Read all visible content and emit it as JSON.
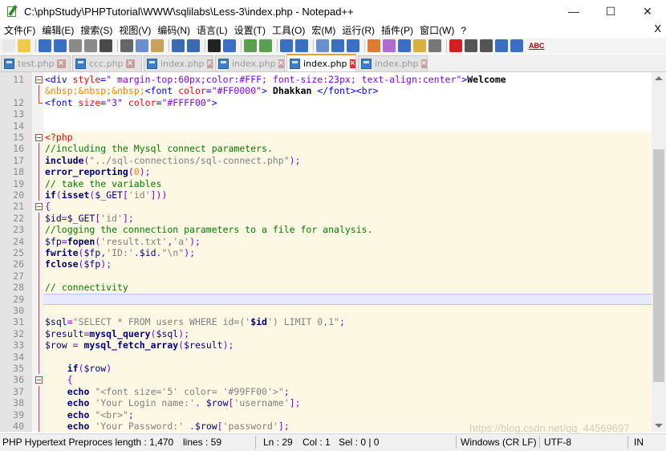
{
  "window": {
    "title": "C:\\phpStudy\\PHPTutorial\\WWW\\sqlilabs\\Less-3\\index.php - Notepad++",
    "minimize": "—",
    "maximize": "☐",
    "close": "✕"
  },
  "menu": {
    "items": [
      "文件(F)",
      "编辑(E)",
      "搜索(S)",
      "视图(V)",
      "编码(N)",
      "语言(L)",
      "设置(T)",
      "工具(O)",
      "宏(M)",
      "运行(R)",
      "插件(P)",
      "窗口(W)",
      "?"
    ],
    "close_doc": "X"
  },
  "toolbar": {
    "icons": [
      "new-file-icon",
      "open-file-icon",
      "save-icon",
      "save-all-icon",
      "close-icon",
      "close-all-icon",
      "print-icon",
      "cut-icon",
      "copy-icon",
      "paste-icon",
      "undo-icon",
      "redo-icon",
      "find-icon",
      "replace-icon",
      "zoom-in-icon",
      "zoom-out-icon",
      "sync-vertical-icon",
      "sync-horizontal-icon",
      "word-wrap-icon",
      "show-all-chars-icon",
      "indent-guide-icon",
      "user-lang-icon",
      "doc-map-icon",
      "function-list-icon",
      "folder-as-workspace-icon",
      "monitoring-icon",
      "record-macro-icon",
      "stop-macro-icon",
      "play-macro-icon",
      "run-macro-multiple-icon",
      "save-macro-icon"
    ],
    "spellcheck": "ABC"
  },
  "tabs": [
    {
      "label": "test.php",
      "active": false
    },
    {
      "label": "ccc.php",
      "active": false
    },
    {
      "label": "index.php",
      "active": false
    },
    {
      "label": "index.php",
      "active": false
    },
    {
      "label": "index.php",
      "active": true
    },
    {
      "label": "index.php",
      "active": false
    }
  ],
  "editor": {
    "current_line": 29,
    "lines": [
      {
        "n": "11",
        "php": false,
        "fold": "box",
        "tokens": [
          [
            "tag",
            "<div "
          ],
          [
            "attr",
            "style"
          ],
          [
            "tag",
            "="
          ],
          [
            "str",
            "\" margin-top:60px;color:#FFF; font-size:23px; text-align:center\""
          ],
          [
            "tag",
            ">"
          ],
          [
            "text",
            "Welcome"
          ]
        ]
      },
      {
        "n": "",
        "php": false,
        "fold": "vl",
        "tokens": [
          [
            "ent",
            "&nbsp;&nbsp;&nbsp;"
          ],
          [
            "tag",
            "<font "
          ],
          [
            "attr",
            "color"
          ],
          [
            "tag",
            "="
          ],
          [
            "str",
            "\"#FF0000\""
          ],
          [
            "tag",
            "> "
          ],
          [
            "text",
            "Dhakkan "
          ],
          [
            "tag",
            "</font><br>"
          ]
        ]
      },
      {
        "n": "12",
        "php": false,
        "fold": "end",
        "tokens": [
          [
            "tag",
            "<font "
          ],
          [
            "attr",
            "size"
          ],
          [
            "tag",
            "="
          ],
          [
            "str",
            "\"3\" "
          ],
          [
            "attr",
            "color"
          ],
          [
            "tag",
            "="
          ],
          [
            "str",
            "\"#FFFF00\""
          ],
          [
            "tag",
            ">"
          ]
        ]
      },
      {
        "n": "13",
        "php": false,
        "fold": "",
        "tokens": []
      },
      {
        "n": "14",
        "php": false,
        "fold": "",
        "tokens": []
      },
      {
        "n": "15",
        "php": true,
        "fold": "box",
        "tokens": [
          [
            "php",
            "<?php"
          ]
        ]
      },
      {
        "n": "16",
        "php": true,
        "fold": "vl",
        "tokens": [
          [
            "cmt",
            "//including the Mysql connect parameters."
          ]
        ]
      },
      {
        "n": "17",
        "php": true,
        "fold": "vl",
        "tokens": [
          [
            "kw",
            "include"
          ],
          [
            "op",
            "("
          ],
          [
            "strd",
            "\"../sql-connections/sql-connect.php\""
          ],
          [
            "op",
            ");"
          ]
        ]
      },
      {
        "n": "18",
        "php": true,
        "fold": "vl",
        "tokens": [
          [
            "kw",
            "error_reporting"
          ],
          [
            "op",
            "("
          ],
          [
            "num",
            "0"
          ],
          [
            "op",
            ");"
          ]
        ]
      },
      {
        "n": "19",
        "php": true,
        "fold": "vl",
        "tokens": [
          [
            "cmt",
            "// take the variables"
          ]
        ]
      },
      {
        "n": "20",
        "php": true,
        "fold": "vl",
        "tokens": [
          [
            "kw",
            "if"
          ],
          [
            "op",
            "("
          ],
          [
            "kw",
            "isset"
          ],
          [
            "op",
            "("
          ],
          [
            "var",
            "$_GET"
          ],
          [
            "op",
            "["
          ],
          [
            "strd",
            "'id'"
          ],
          [
            "op",
            "]))"
          ]
        ]
      },
      {
        "n": "21",
        "php": true,
        "fold": "box",
        "tokens": [
          [
            "op",
            "{"
          ]
        ]
      },
      {
        "n": "22",
        "php": true,
        "fold": "vl",
        "tokens": [
          [
            "var",
            "$id"
          ],
          [
            "op",
            "="
          ],
          [
            "var",
            "$_GET"
          ],
          [
            "op",
            "["
          ],
          [
            "strd",
            "'id'"
          ],
          [
            "op",
            "];"
          ]
        ]
      },
      {
        "n": "23",
        "php": true,
        "fold": "vl",
        "tokens": [
          [
            "cmt",
            "//logging the connection parameters to a file for analysis."
          ]
        ]
      },
      {
        "n": "24",
        "php": true,
        "fold": "vl",
        "tokens": [
          [
            "var",
            "$fp"
          ],
          [
            "op",
            "="
          ],
          [
            "kw",
            "fopen"
          ],
          [
            "op",
            "("
          ],
          [
            "strd",
            "'result.txt'"
          ],
          [
            "op",
            ","
          ],
          [
            "strd",
            "'a'"
          ],
          [
            "op",
            ");"
          ]
        ]
      },
      {
        "n": "25",
        "php": true,
        "fold": "vl",
        "tokens": [
          [
            "kw",
            "fwrite"
          ],
          [
            "op",
            "("
          ],
          [
            "var",
            "$fp"
          ],
          [
            "op",
            ","
          ],
          [
            "strd",
            "'ID:'"
          ],
          [
            "op",
            "."
          ],
          [
            "var",
            "$id"
          ],
          [
            "op",
            "."
          ],
          [
            "strd",
            "\"\\n\""
          ],
          [
            "op",
            ");"
          ]
        ]
      },
      {
        "n": "26",
        "php": true,
        "fold": "vl",
        "tokens": [
          [
            "kw",
            "fclose"
          ],
          [
            "op",
            "("
          ],
          [
            "var",
            "$fp"
          ],
          [
            "op",
            ");"
          ]
        ]
      },
      {
        "n": "27",
        "php": true,
        "fold": "vl",
        "tokens": []
      },
      {
        "n": "28",
        "php": true,
        "fold": "vl",
        "tokens": [
          [
            "cmt",
            "// connectivity"
          ]
        ]
      },
      {
        "n": "29",
        "php": true,
        "fold": "vl",
        "tokens": [],
        "current": true
      },
      {
        "n": "30",
        "php": true,
        "fold": "vl",
        "tokens": []
      },
      {
        "n": "31",
        "php": true,
        "fold": "vl",
        "tokens": [
          [
            "var",
            "$sql"
          ],
          [
            "op",
            "="
          ],
          [
            "strd",
            "\"SELECT * FROM users WHERE id=('"
          ],
          [
            "kw",
            "$id"
          ],
          [
            "strd",
            "') LIMIT 0,1\""
          ],
          [
            "op",
            ";"
          ]
        ]
      },
      {
        "n": "32",
        "php": true,
        "fold": "vl",
        "tokens": [
          [
            "var",
            "$result"
          ],
          [
            "op",
            "="
          ],
          [
            "kw",
            "mysql_query"
          ],
          [
            "op",
            "("
          ],
          [
            "var",
            "$sql"
          ],
          [
            "op",
            ");"
          ]
        ]
      },
      {
        "n": "33",
        "php": true,
        "fold": "vl",
        "tokens": [
          [
            "var",
            "$row "
          ],
          [
            "op",
            "= "
          ],
          [
            "kw",
            "mysql_fetch_array"
          ],
          [
            "op",
            "("
          ],
          [
            "var",
            "$result"
          ],
          [
            "op",
            ");"
          ]
        ]
      },
      {
        "n": "34",
        "php": true,
        "fold": "vl",
        "tokens": []
      },
      {
        "n": "35",
        "php": true,
        "fold": "vl",
        "tokens": [
          [
            "plain",
            "    "
          ],
          [
            "kw",
            "if"
          ],
          [
            "op",
            "("
          ],
          [
            "var",
            "$row"
          ],
          [
            "op",
            ")"
          ]
        ]
      },
      {
        "n": "36",
        "php": true,
        "fold": "box",
        "tokens": [
          [
            "plain",
            "    "
          ],
          [
            "op",
            "{"
          ]
        ]
      },
      {
        "n": "37",
        "php": true,
        "fold": "vl",
        "tokens": [
          [
            "plain",
            "    "
          ],
          [
            "kw",
            "echo "
          ],
          [
            "strd",
            "\"<font size='5' color= '#99FF00'>\""
          ],
          [
            "op",
            ";"
          ]
        ]
      },
      {
        "n": "38",
        "php": true,
        "fold": "vl",
        "tokens": [
          [
            "plain",
            "    "
          ],
          [
            "kw",
            "echo "
          ],
          [
            "strd",
            "'Your Login name:'"
          ],
          [
            "op",
            ". "
          ],
          [
            "var",
            "$row"
          ],
          [
            "op",
            "["
          ],
          [
            "strd",
            "'username'"
          ],
          [
            "op",
            "];"
          ]
        ]
      },
      {
        "n": "39",
        "php": true,
        "fold": "vl",
        "tokens": [
          [
            "plain",
            "    "
          ],
          [
            "kw",
            "echo "
          ],
          [
            "strd",
            "\"<br>\""
          ],
          [
            "op",
            ";"
          ]
        ]
      },
      {
        "n": "40",
        "php": true,
        "fold": "vl",
        "tokens": [
          [
            "plain",
            "    "
          ],
          [
            "kw",
            "echo "
          ],
          [
            "strd",
            "'Your Password:'"
          ],
          [
            "op",
            " ."
          ],
          [
            "var",
            "$row"
          ],
          [
            "op",
            "["
          ],
          [
            "strd",
            "'password'"
          ],
          [
            "op",
            "];"
          ]
        ]
      }
    ]
  },
  "status": {
    "filetype": "PHP Hypertext Preproces length : 1,470",
    "lines": "lines : 59",
    "ln": "Ln : 29",
    "col": "Col : 1",
    "sel": "Sel : 0 | 0",
    "eol": "Windows (CR LF)",
    "encoding": "UTF-8",
    "mode": "IN"
  },
  "watermark": "https://blog.csdn.net/qq_44569697",
  "colors": {
    "php_bg": "#fdf8e3",
    "current_line": "#e8e8ff",
    "tag": "#0000ff",
    "attr": "#ff0000",
    "comment": "#008000",
    "keyword": "#000080"
  }
}
